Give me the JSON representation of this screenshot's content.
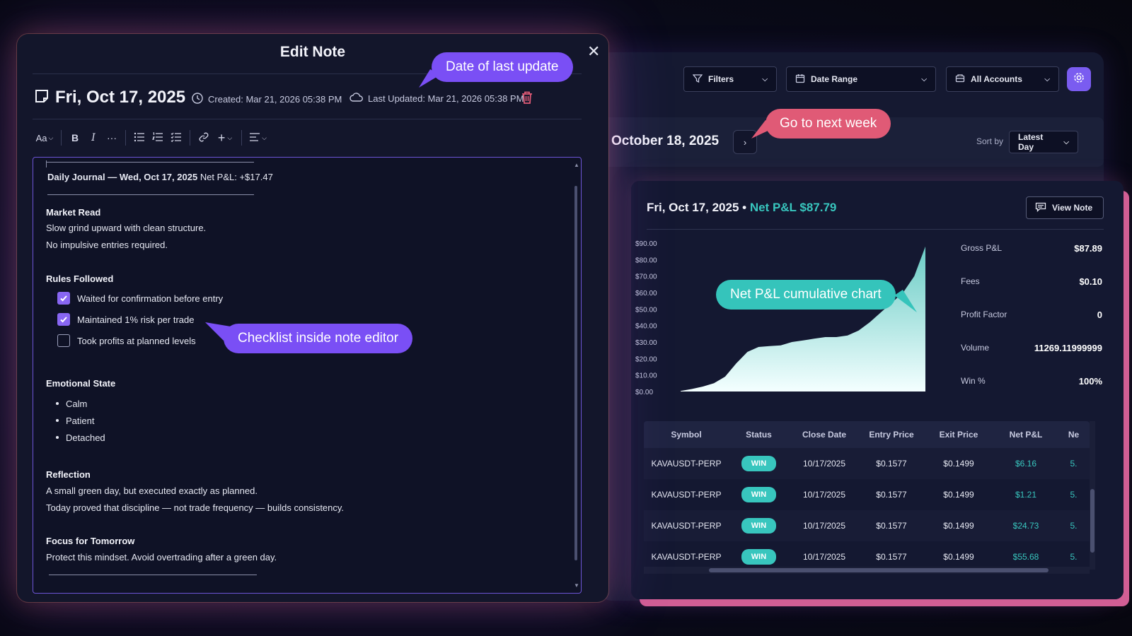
{
  "modal": {
    "title": "Edit Note",
    "date": "Fri, Oct 17, 2025",
    "created": "Created: Mar 21, 2026 05:38 PM",
    "last_updated": "Last Updated: Mar 21, 2026 05:38 PM",
    "toolbar_font_label": "Aa"
  },
  "note": {
    "journal_title": "Daily Journal — Wed, Oct 17, 2025",
    "journal_pnl": "Net P&L: +$17.47",
    "market_read_heading": "Market Read",
    "market_read_lines": [
      "Slow grind upward with clean structure.",
      "No impulsive entries required."
    ],
    "rules_heading": "Rules Followed",
    "rules": [
      {
        "label": "Waited for confirmation before entry",
        "checked": true
      },
      {
        "label": "Maintained 1% risk per trade",
        "checked": true
      },
      {
        "label": "Took profits at planned levels",
        "checked": false
      }
    ],
    "emotional_heading": "Emotional State",
    "emotions": [
      "Calm",
      "Patient",
      "Detached"
    ],
    "reflection_heading": "Reflection",
    "reflection_lines": [
      "A small green day, but executed exactly as planned.",
      "Today proved that discipline — not trade frequency — builds consistency."
    ],
    "focus_heading": "Focus for Tomorrow",
    "focus_line": "Protect this mindset. Avoid overtrading after a green day."
  },
  "dashboard": {
    "filters_label": "Filters",
    "date_range_label": "Date Range",
    "accounts_label": "All Accounts",
    "week_title": "October 18, 2025",
    "sort_by_label": "Sort by",
    "sort_value": "Latest Day"
  },
  "day": {
    "title": "Fri, Oct 17, 2025",
    "separator": "•",
    "net_pnl": "Net P&L $87.79",
    "view_note_label": "View Note",
    "stats": [
      {
        "label": "Gross P&L",
        "value": "$87.89"
      },
      {
        "label": "Fees",
        "value": "$0.10"
      },
      {
        "label": "Profit Factor",
        "value": "0"
      },
      {
        "label": "Volume",
        "value": "11269.11999999"
      },
      {
        "label": "Win %",
        "value": "100%"
      }
    ]
  },
  "chart_data": {
    "type": "area",
    "y_ticks": [
      "$90.00",
      "$80.00",
      "$70.00",
      "$60.00",
      "$50.00",
      "$40.00",
      "$30.00",
      "$20.00",
      "$10.00",
      "$0.00"
    ],
    "ylim": [
      0,
      90
    ],
    "values": [
      0.3,
      1.5,
      3,
      5,
      9,
      17,
      24,
      27,
      27.5,
      28,
      30,
      31,
      32,
      33,
      33,
      34,
      37,
      42,
      48,
      54,
      60,
      70,
      88
    ],
    "color": "#38c6be"
  },
  "table": {
    "columns": [
      "Symbol",
      "Status",
      "Close Date",
      "Entry Price",
      "Exit Price",
      "Net P&L",
      "Ne"
    ],
    "rows": [
      {
        "symbol": "KAVAUSDT-PERP",
        "status": "WIN",
        "close_date": "10/17/2025",
        "entry": "$0.1577",
        "exit": "$0.1499",
        "pnl": "$6.16",
        "extra": "5."
      },
      {
        "symbol": "KAVAUSDT-PERP",
        "status": "WIN",
        "close_date": "10/17/2025",
        "entry": "$0.1577",
        "exit": "$0.1499",
        "pnl": "$1.21",
        "extra": "5."
      },
      {
        "symbol": "KAVAUSDT-PERP",
        "status": "WIN",
        "close_date": "10/17/2025",
        "entry": "$0.1577",
        "exit": "$0.1499",
        "pnl": "$24.73",
        "extra": "5."
      },
      {
        "symbol": "KAVAUSDT-PERP",
        "status": "WIN",
        "close_date": "10/17/2025",
        "entry": "$0.1577",
        "exit": "$0.1499",
        "pnl": "$55.68",
        "extra": "5."
      }
    ]
  },
  "callouts": {
    "last_update": "Date of last update",
    "next_week": "Go to next week",
    "chart": "Net P&L cumulative chart",
    "checklist": "Checklist inside note editor"
  },
  "colors": {
    "accent": "#7a5cf0",
    "profit": "#38c6be",
    "delete": "#e05a76"
  }
}
